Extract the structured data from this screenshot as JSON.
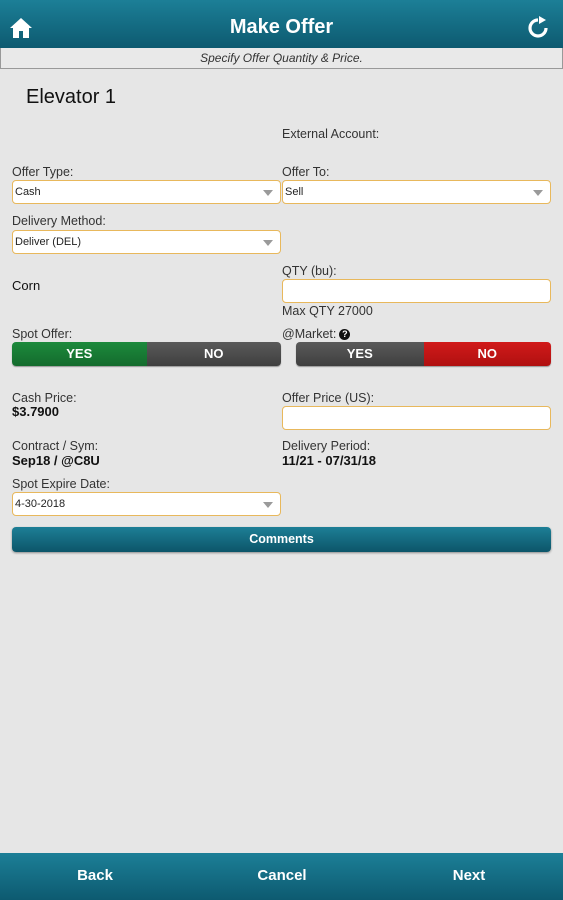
{
  "header": {
    "title": "Make Offer",
    "home_icon": "home-icon",
    "refresh_icon": "refresh-icon"
  },
  "subheader": {
    "text": "Specify Offer Quantity & Price."
  },
  "elevator": {
    "name": "Elevator 1"
  },
  "external_account": {
    "label": "External Account:"
  },
  "offer_type": {
    "label": "Offer Type:",
    "value": "Cash"
  },
  "offer_to": {
    "label": "Offer To:",
    "value": "Sell"
  },
  "delivery_method": {
    "label": "Delivery Method:",
    "value": "Deliver (DEL)"
  },
  "commodity": {
    "name": "Corn"
  },
  "qty": {
    "label": "QTY (bu):",
    "value": "",
    "max": "Max QTY 27000"
  },
  "spot_offer": {
    "label": "Spot Offer:",
    "yes": "YES",
    "no": "NO",
    "selected": "YES"
  },
  "at_market": {
    "label": "@Market:",
    "help_icon": "question-circle-icon",
    "yes": "YES",
    "no": "NO",
    "selected": "NO"
  },
  "cash_price": {
    "label": "Cash Price:",
    "value": "$3.7900"
  },
  "offer_price": {
    "label": "Offer Price (US):",
    "value": ""
  },
  "contract": {
    "label": "Contract / Sym:",
    "value": "Sep18 / @C8U"
  },
  "delivery_period": {
    "label": "Delivery Period:",
    "value": "11/21 - 07/31/18"
  },
  "spot_expire": {
    "label": "Spot Expire Date:",
    "value": "4-30-2018"
  },
  "comments": {
    "label": "Comments"
  },
  "footer": {
    "back": "Back",
    "cancel": "Cancel",
    "next": "Next"
  },
  "colors": {
    "header": "#136a82",
    "yes_active": "#17803a",
    "no_active": "#c41414",
    "inactive": "#4d4d4d",
    "field_border": "#e8b85c"
  }
}
